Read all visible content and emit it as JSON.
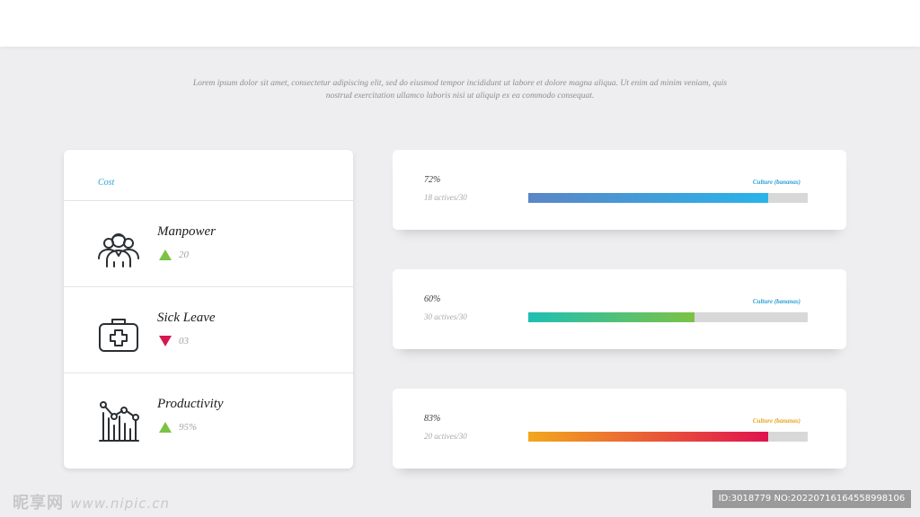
{
  "intro": {
    "line1": "Lorem ipsum dolor sit amet, consectetur adipiscing elit, sed do eiusmod tempor incididunt ut labore et dolore magna aliqua. Ut enim ad minim veniam, quis",
    "line2": "nostrud exercitation ullamco laboris nisi ut aliquip ex ea commodo consequat."
  },
  "panel": {
    "heading": "Cost",
    "metrics": [
      {
        "label": "Manpower",
        "value": "20",
        "trend": "up",
        "icon": "team-icon"
      },
      {
        "label": "Sick Leave",
        "value": "03",
        "trend": "down",
        "icon": "medical-kit-icon"
      },
      {
        "label": "Productivity",
        "value": "95%",
        "trend": "up",
        "icon": "bar-chart-icon"
      }
    ]
  },
  "bars": [
    {
      "percent": "72%",
      "sub": "18 actives/30",
      "tag": "Culture (bananas)",
      "progress": 0.86,
      "tag_color": "#2a9fd6",
      "gradient": [
        "#5b86c6",
        "#29b3ea"
      ]
    },
    {
      "percent": "60%",
      "sub": "30 actives/30",
      "tag": "Culture (bananas)",
      "progress": 0.595,
      "tag_color": "#2a9fd6",
      "gradient": [
        "#1fbfb3",
        "#7cc245"
      ]
    },
    {
      "percent": "83%",
      "sub": "20 actives/30",
      "tag": "Culture (bananas)",
      "progress": 0.86,
      "tag_color": "#e8a21b",
      "gradient": [
        "#f2a81e",
        "#e0124f"
      ]
    }
  ],
  "colors": {
    "background": "#eeeef0",
    "accent_blue": "#2a9fd6",
    "trend_up": "#7cc245",
    "trend_down": "#d6164f",
    "track": "#d8d8d8"
  },
  "watermark": {
    "brand": "昵享网",
    "url": "www.nipic.cn",
    "id_text": "ID:3018779 NO:20220716164558998106"
  }
}
